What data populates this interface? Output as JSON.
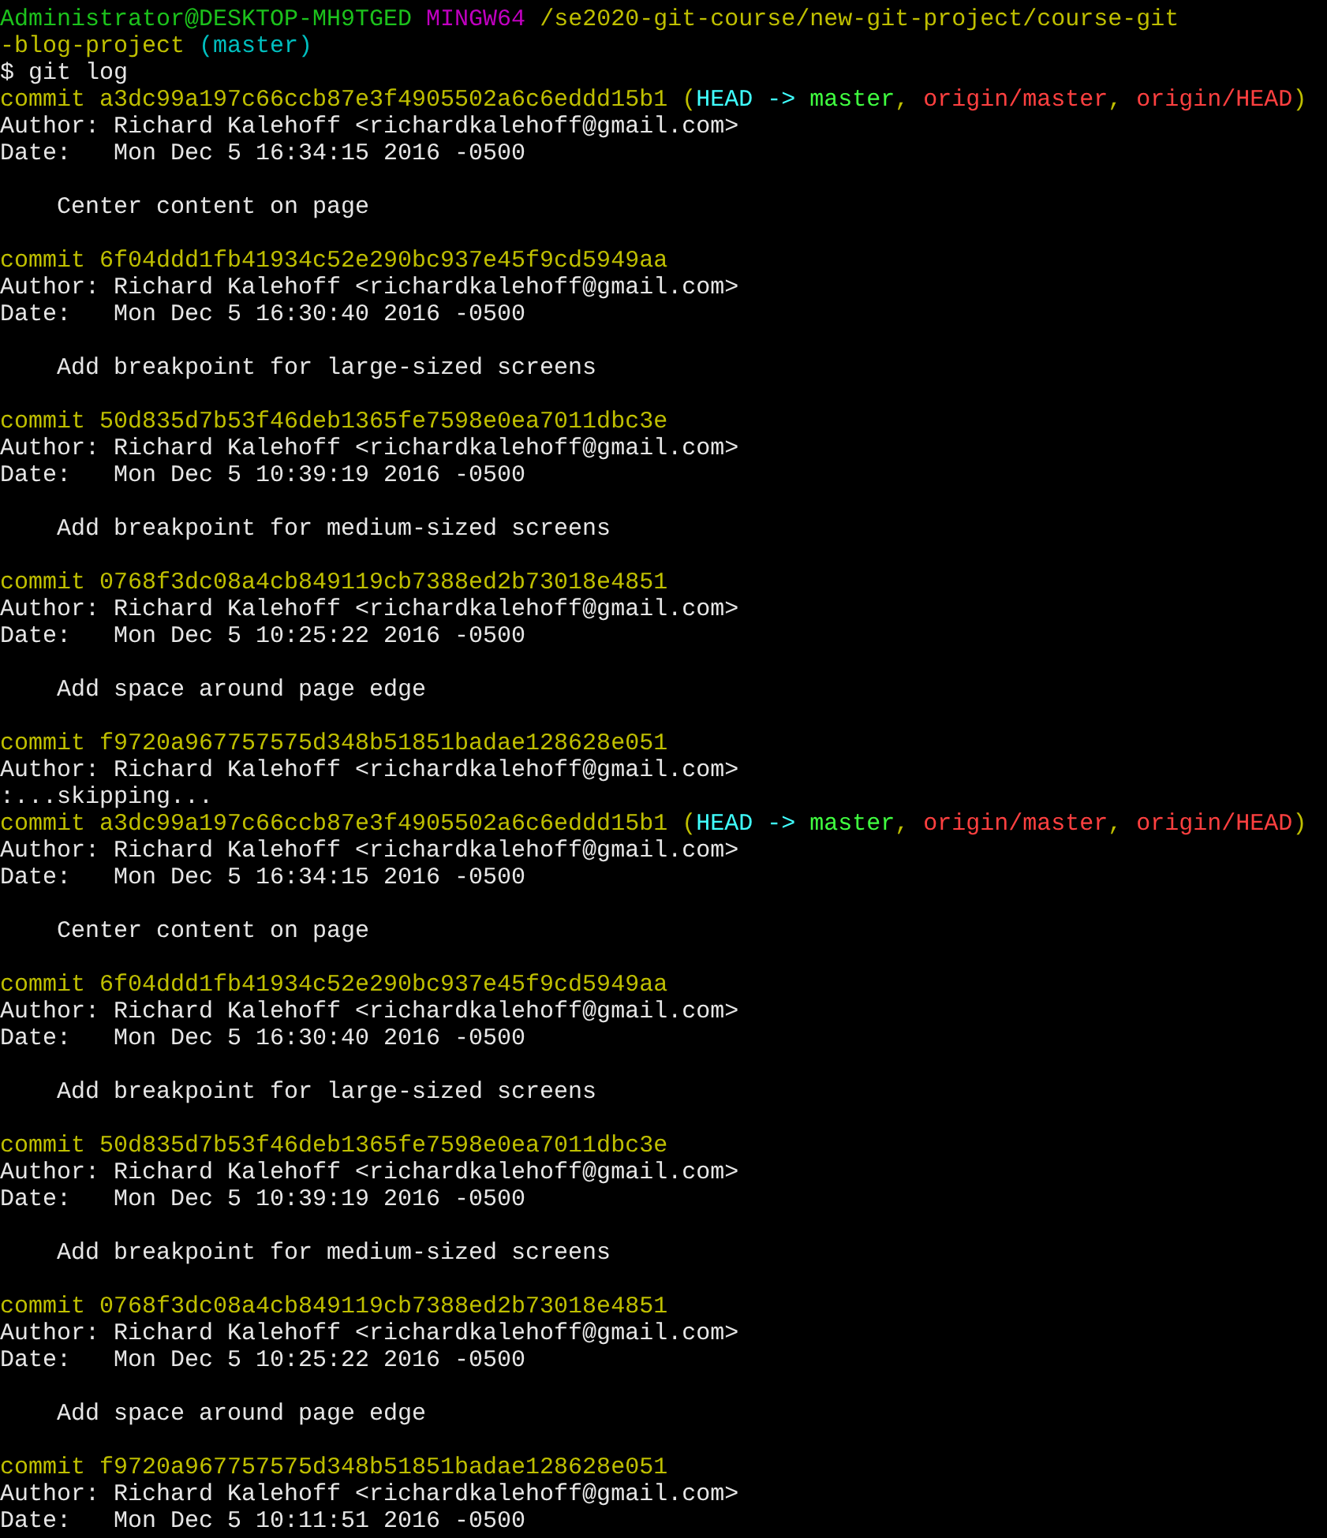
{
  "terminal": {
    "lines": [
      {
        "kind": "text",
        "segments": [
          {
            "kind": "user",
            "text": "Administrator@DESKTOP-MH9TGED "
          },
          {
            "kind": "system",
            "text": "MINGW64 "
          },
          {
            "kind": "path",
            "text": "/se2020-git-course/new-git-project/course-git"
          }
        ]
      },
      {
        "kind": "text",
        "segments": [
          {
            "kind": "path",
            "text": "-blog-project "
          },
          {
            "kind": "branch",
            "text": "(master)"
          }
        ]
      },
      {
        "kind": "text",
        "segments": [
          {
            "kind": "plain",
            "text": "$ git log"
          }
        ]
      },
      {
        "kind": "text",
        "segments": [
          {
            "kind": "commit",
            "text": "commit a3dc99a197c66ccb87e3f4905502a6c6eddd15b1 ("
          },
          {
            "kind": "head",
            "text": "HEAD -> "
          },
          {
            "kind": "local",
            "text": "master"
          },
          {
            "kind": "commit",
            "text": ", "
          },
          {
            "kind": "remote",
            "text": "origin/master"
          },
          {
            "kind": "commit",
            "text": ", "
          },
          {
            "kind": "remote",
            "text": "origin/HEAD"
          },
          {
            "kind": "commit",
            "text": ")"
          }
        ]
      },
      {
        "kind": "text",
        "segments": [
          {
            "kind": "plain",
            "text": "Author: Richard Kalehoff <richardkalehoff@gmail.com>"
          }
        ]
      },
      {
        "kind": "text",
        "segments": [
          {
            "kind": "plain",
            "text": "Date:   Mon Dec 5 16:34:15 2016 -0500"
          }
        ]
      },
      {
        "kind": "blank"
      },
      {
        "kind": "text",
        "segments": [
          {
            "kind": "plain",
            "text": "    Center content on page"
          }
        ]
      },
      {
        "kind": "blank"
      },
      {
        "kind": "text",
        "segments": [
          {
            "kind": "commit",
            "text": "commit 6f04ddd1fb41934c52e290bc937e45f9cd5949aa"
          }
        ]
      },
      {
        "kind": "text",
        "segments": [
          {
            "kind": "plain",
            "text": "Author: Richard Kalehoff <richardkalehoff@gmail.com>"
          }
        ]
      },
      {
        "kind": "text",
        "segments": [
          {
            "kind": "plain",
            "text": "Date:   Mon Dec 5 16:30:40 2016 -0500"
          }
        ]
      },
      {
        "kind": "blank"
      },
      {
        "kind": "text",
        "segments": [
          {
            "kind": "plain",
            "text": "    Add breakpoint for large-sized screens"
          }
        ]
      },
      {
        "kind": "blank"
      },
      {
        "kind": "text",
        "segments": [
          {
            "kind": "commit",
            "text": "commit 50d835d7b53f46deb1365fe7598e0ea7011dbc3e"
          }
        ]
      },
      {
        "kind": "text",
        "segments": [
          {
            "kind": "plain",
            "text": "Author: Richard Kalehoff <richardkalehoff@gmail.com>"
          }
        ]
      },
      {
        "kind": "text",
        "segments": [
          {
            "kind": "plain",
            "text": "Date:   Mon Dec 5 10:39:19 2016 -0500"
          }
        ]
      },
      {
        "kind": "blank"
      },
      {
        "kind": "text",
        "segments": [
          {
            "kind": "plain",
            "text": "    Add breakpoint for medium-sized screens"
          }
        ]
      },
      {
        "kind": "blank"
      },
      {
        "kind": "text",
        "segments": [
          {
            "kind": "commit",
            "text": "commit 0768f3dc08a4cb849119cb7388ed2b73018e4851"
          }
        ]
      },
      {
        "kind": "text",
        "segments": [
          {
            "kind": "plain",
            "text": "Author: Richard Kalehoff <richardkalehoff@gmail.com>"
          }
        ]
      },
      {
        "kind": "text",
        "segments": [
          {
            "kind": "plain",
            "text": "Date:   Mon Dec 5 10:25:22 2016 -0500"
          }
        ]
      },
      {
        "kind": "blank"
      },
      {
        "kind": "text",
        "segments": [
          {
            "kind": "plain",
            "text": "    Add space around page edge"
          }
        ]
      },
      {
        "kind": "blank"
      },
      {
        "kind": "text",
        "segments": [
          {
            "kind": "commit",
            "text": "commit f9720a967757575d348b51851badae128628e051"
          }
        ]
      },
      {
        "kind": "text",
        "segments": [
          {
            "kind": "plain",
            "text": "Author: Richard Kalehoff <richardkalehoff@gmail.com>"
          }
        ]
      },
      {
        "kind": "text",
        "segments": [
          {
            "kind": "plain",
            "text": ":...skipping..."
          }
        ]
      },
      {
        "kind": "text",
        "segments": [
          {
            "kind": "commit",
            "text": "commit a3dc99a197c66ccb87e3f4905502a6c6eddd15b1 ("
          },
          {
            "kind": "head",
            "text": "HEAD -> "
          },
          {
            "kind": "local",
            "text": "master"
          },
          {
            "kind": "commit",
            "text": ", "
          },
          {
            "kind": "remote",
            "text": "origin/master"
          },
          {
            "kind": "commit",
            "text": ", "
          },
          {
            "kind": "remote",
            "text": "origin/HEAD"
          },
          {
            "kind": "commit",
            "text": ")"
          }
        ]
      },
      {
        "kind": "text",
        "segments": [
          {
            "kind": "plain",
            "text": "Author: Richard Kalehoff <richardkalehoff@gmail.com>"
          }
        ]
      },
      {
        "kind": "text",
        "segments": [
          {
            "kind": "plain",
            "text": "Date:   Mon Dec 5 16:34:15 2016 -0500"
          }
        ]
      },
      {
        "kind": "blank"
      },
      {
        "kind": "text",
        "segments": [
          {
            "kind": "plain",
            "text": "    Center content on page"
          }
        ]
      },
      {
        "kind": "blank"
      },
      {
        "kind": "text",
        "segments": [
          {
            "kind": "commit",
            "text": "commit 6f04ddd1fb41934c52e290bc937e45f9cd5949aa"
          }
        ]
      },
      {
        "kind": "text",
        "segments": [
          {
            "kind": "plain",
            "text": "Author: Richard Kalehoff <richardkalehoff@gmail.com>"
          }
        ]
      },
      {
        "kind": "text",
        "segments": [
          {
            "kind": "plain",
            "text": "Date:   Mon Dec 5 16:30:40 2016 -0500"
          }
        ]
      },
      {
        "kind": "blank"
      },
      {
        "kind": "text",
        "segments": [
          {
            "kind": "plain",
            "text": "    Add breakpoint for large-sized screens"
          }
        ]
      },
      {
        "kind": "blank"
      },
      {
        "kind": "text",
        "segments": [
          {
            "kind": "commit",
            "text": "commit 50d835d7b53f46deb1365fe7598e0ea7011dbc3e"
          }
        ]
      },
      {
        "kind": "text",
        "segments": [
          {
            "kind": "plain",
            "text": "Author: Richard Kalehoff <richardkalehoff@gmail.com>"
          }
        ]
      },
      {
        "kind": "text",
        "segments": [
          {
            "kind": "plain",
            "text": "Date:   Mon Dec 5 10:39:19 2016 -0500"
          }
        ]
      },
      {
        "kind": "blank"
      },
      {
        "kind": "text",
        "segments": [
          {
            "kind": "plain",
            "text": "    Add breakpoint for medium-sized screens"
          }
        ]
      },
      {
        "kind": "blank"
      },
      {
        "kind": "text",
        "segments": [
          {
            "kind": "commit",
            "text": "commit 0768f3dc08a4cb849119cb7388ed2b73018e4851"
          }
        ]
      },
      {
        "kind": "text",
        "segments": [
          {
            "kind": "plain",
            "text": "Author: Richard Kalehoff <richardkalehoff@gmail.com>"
          }
        ]
      },
      {
        "kind": "text",
        "segments": [
          {
            "kind": "plain",
            "text": "Date:   Mon Dec 5 10:25:22 2016 -0500"
          }
        ]
      },
      {
        "kind": "blank"
      },
      {
        "kind": "text",
        "segments": [
          {
            "kind": "plain",
            "text": "    Add space around page edge"
          }
        ]
      },
      {
        "kind": "blank"
      },
      {
        "kind": "text",
        "segments": [
          {
            "kind": "commit",
            "text": "commit f9720a967757575d348b51851badae128628e051"
          }
        ]
      },
      {
        "kind": "text",
        "segments": [
          {
            "kind": "plain",
            "text": "Author: Richard Kalehoff <richardkalehoff@gmail.com>"
          }
        ]
      },
      {
        "kind": "text",
        "segments": [
          {
            "kind": "plain",
            "text": "Date:   Mon Dec 5 10:11:51 2016 -0500"
          }
        ]
      }
    ]
  }
}
